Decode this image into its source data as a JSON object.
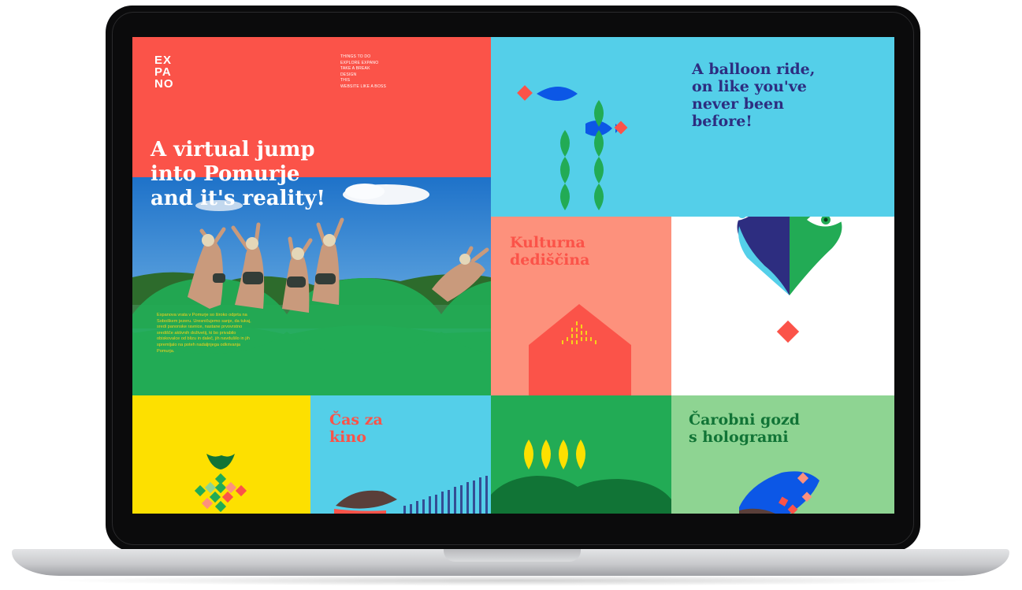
{
  "brand": {
    "logo_lines": [
      "EX",
      "PA",
      "NO"
    ]
  },
  "nav": {
    "items": [
      "THINGS TO DO",
      "EXPLORE EXPANO",
      "TAKE A BREAK",
      "DESIGN",
      "THIS",
      "WEBSITE LIKE A BOSS"
    ]
  },
  "hero": {
    "title_lines": [
      "A virtual jump",
      "into Pomurje",
      "and it's reality!"
    ],
    "body": "Expanova vrata v Pomurje so široko odprta na Soboškem jezeru. Uresničujemo sanje, da tukaj, sredi panonske ravnice, nastane prvovrstno središče aktivnih doživetij, ki bo privabilo obiskovalce od blizu in daleč, jih navdušilo in jih spremljalo na poteh nadaljnjega odkrivanja Pomurja."
  },
  "tiles": {
    "balloon": {
      "title_lines": [
        "A balloon ride,",
        "on like you've",
        "never been",
        "before!"
      ]
    },
    "kultura": {
      "title_lines": [
        "Kulturna",
        "dediščina"
      ]
    },
    "kino": {
      "title_lines": [
        "Čas za",
        "kino"
      ]
    },
    "gozd": {
      "title_lines": [
        "Čarobni gozd",
        "s hologrami"
      ]
    }
  },
  "colors": {
    "coral": "#fb5349",
    "sky": "#54cfe9",
    "green": "#22ab55",
    "salmon": "#fd917c",
    "yellow": "#fde000",
    "mint": "#8ed492",
    "navy": "#2d2d80",
    "blue": "#0c57e6",
    "dark_green": "#117436"
  },
  "icons": [
    "decorative-pattern-icon",
    "fish-icon",
    "leaf-chain-icon",
    "balloon-icon",
    "house-icon",
    "pineapple-icon",
    "tulip-icon",
    "frog-icon"
  ]
}
